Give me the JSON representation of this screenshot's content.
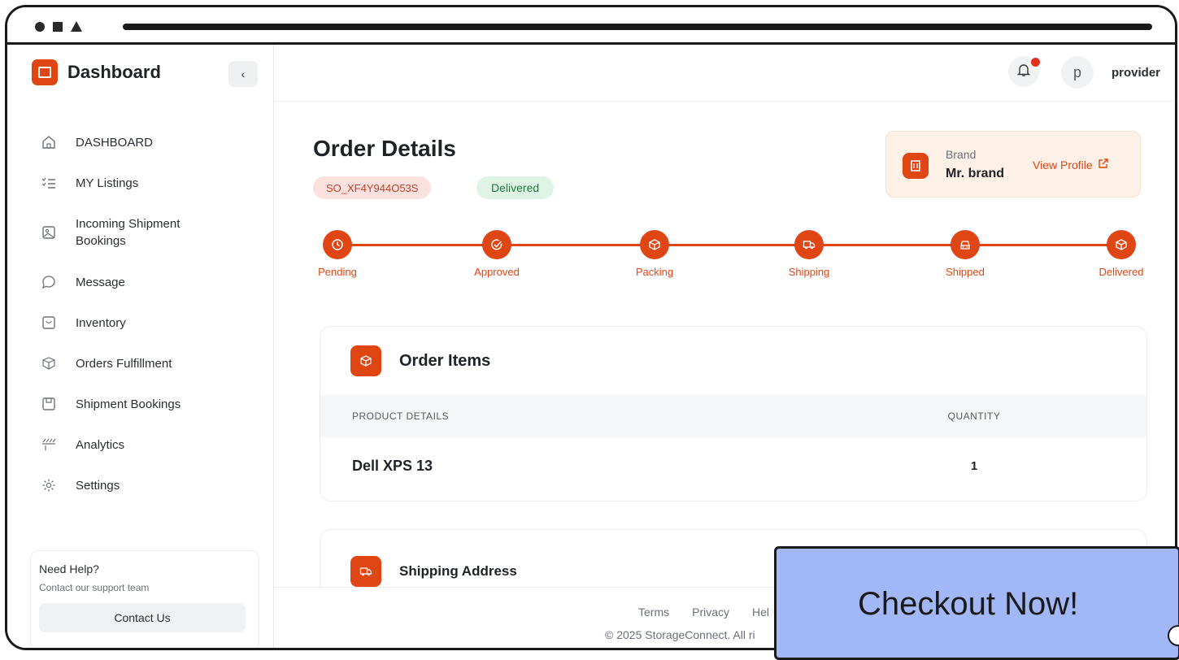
{
  "app": {
    "title": "Dashboard",
    "collapse_glyph": "‹"
  },
  "sidebar": {
    "items": [
      {
        "label": "DASHBOARD",
        "icon": "home-icon"
      },
      {
        "label": "MY Listings",
        "icon": "list-icon"
      },
      {
        "label": "Incoming Shipment Bookings",
        "icon": "image-icon"
      },
      {
        "label": "Message",
        "icon": "chat-icon"
      },
      {
        "label": "Inventory",
        "icon": "box-icon"
      },
      {
        "label": "Orders Fulfillment",
        "icon": "package-icon"
      },
      {
        "label": "Shipment Bookings",
        "icon": "booking-icon"
      },
      {
        "label": "Analytics",
        "icon": "analytics-icon"
      },
      {
        "label": "Settings",
        "icon": "gear-icon"
      }
    ],
    "help": {
      "title": "Need Help?",
      "subtitle": "Contact our support team",
      "button": "Contact Us"
    }
  },
  "topbar": {
    "avatar_initial": "p",
    "user_name": "provider"
  },
  "order": {
    "title": "Order Details",
    "id": "SO_XF4Y944O53S",
    "status": "Delivered",
    "brand_label": "Brand",
    "brand_name": "Mr. brand",
    "view_profile": "View Profile"
  },
  "tracker": {
    "steps": [
      "Pending",
      "Approved",
      "Packing",
      "Shipping",
      "Shipped",
      "Delivered"
    ],
    "progress": 1.0
  },
  "items": {
    "title": "Order Items",
    "columns": [
      "PRODUCT DETAILS",
      "QUANTITY"
    ],
    "rows": [
      {
        "product": "Dell XPS 13",
        "quantity": "1"
      }
    ]
  },
  "shipping": {
    "title": "Shipping Address"
  },
  "footer": {
    "links": [
      "Terms",
      "Privacy",
      "Hel"
    ],
    "copyright": "© 2025 StorageConnect. All ri"
  },
  "overlay": {
    "label": "Checkout Now!"
  },
  "colors": {
    "accent": "#e04614",
    "delivered_bg": "#dff4e5",
    "order_id_bg": "#fbe2df",
    "overlay_bg": "#a2b8f6"
  }
}
